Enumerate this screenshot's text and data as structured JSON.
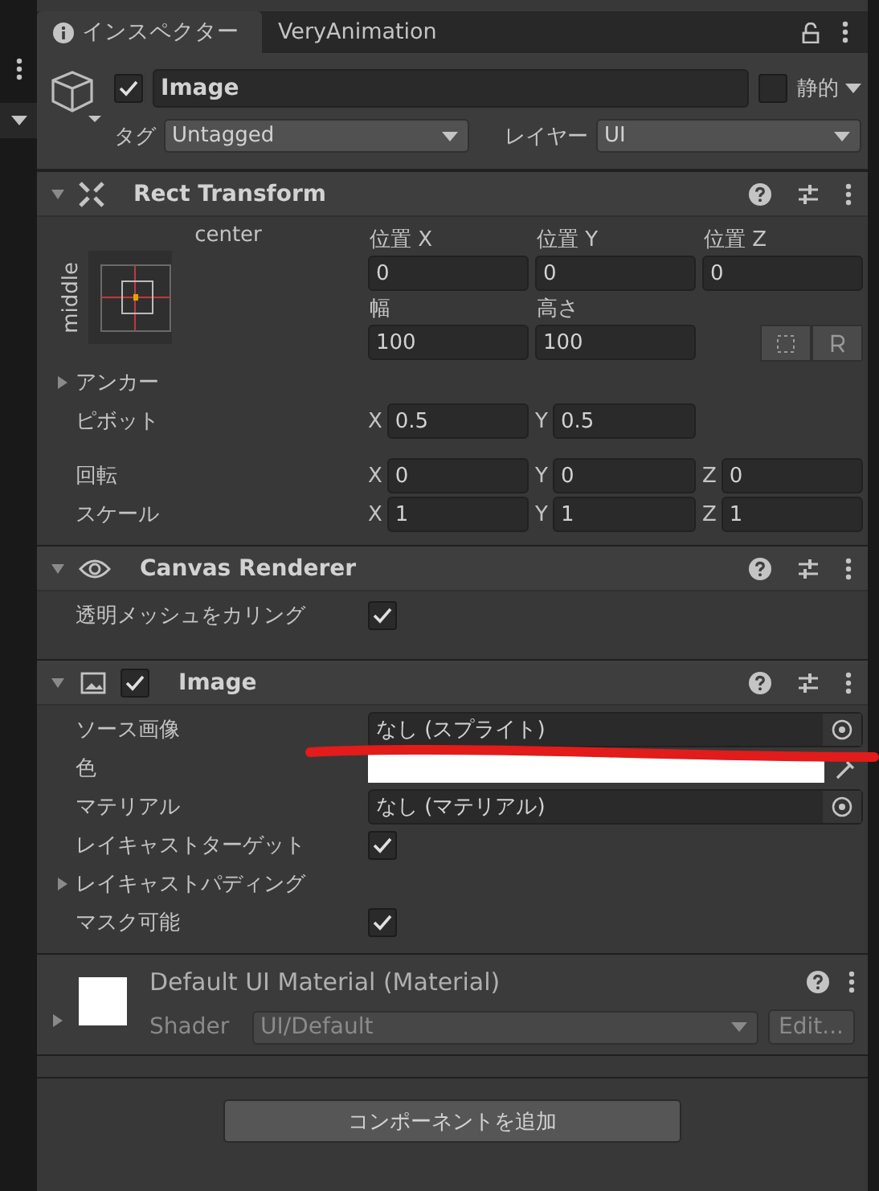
{
  "tabs": [
    {
      "label": "インスペクター",
      "selected": true
    },
    {
      "label": "VeryAnimation",
      "selected": false
    }
  ],
  "game_object": {
    "active": true,
    "name": "Image",
    "static": false,
    "static_label": "静的",
    "tag_label": "タグ",
    "tag": "Untagged",
    "layer_label": "レイヤー",
    "layer": "UI"
  },
  "rect_transform": {
    "title": "Rect Transform",
    "expanded": true,
    "anchor_h": "center",
    "anchor_v": "middle",
    "top_fields": [
      {
        "label": "位置 X",
        "value": "0"
      },
      {
        "label": "位置 Y",
        "value": "0"
      },
      {
        "label": "位置 Z",
        "value": "0"
      },
      {
        "label": "幅",
        "value": "100"
      },
      {
        "label": "高さ",
        "value": "100"
      }
    ],
    "anchors": {
      "label": "アンカー",
      "expanded": false
    },
    "vector_rows": [
      {
        "label": "ピボット",
        "fields": [
          {
            "axis": "X",
            "value": "0.5"
          },
          {
            "axis": "Y",
            "value": "0.5"
          }
        ]
      },
      {
        "label": "回転",
        "fields": [
          {
            "axis": "X",
            "value": "0"
          },
          {
            "axis": "Y",
            "value": "0"
          },
          {
            "axis": "Z",
            "value": "0"
          }
        ]
      },
      {
        "label": "スケール",
        "fields": [
          {
            "axis": "X",
            "value": "1"
          },
          {
            "axis": "Y",
            "value": "1"
          },
          {
            "axis": "Z",
            "value": "1"
          }
        ]
      }
    ]
  },
  "canvas_renderer": {
    "title": "Canvas Renderer",
    "expanded": true,
    "rows": [
      {
        "kind": "checkbox",
        "label": "透明メッシュをカリング",
        "checked": true
      }
    ]
  },
  "image": {
    "title": "Image",
    "expanded": true,
    "enabled": true,
    "rows": [
      {
        "kind": "object",
        "label": "ソース画像",
        "value": "なし (スプライト)"
      },
      {
        "kind": "color",
        "label": "色",
        "color": "#ffffff"
      },
      {
        "kind": "object",
        "label": "マテリアル",
        "value": "なし (マテリアル)"
      },
      {
        "kind": "checkbox",
        "label": "レイキャストターゲット",
        "checked": true
      },
      {
        "kind": "foldout",
        "label": "レイキャストパディング",
        "expanded": false
      },
      {
        "kind": "checkbox",
        "label": "マスク可能",
        "checked": true
      }
    ]
  },
  "material": {
    "title": "Default UI Material (Material)",
    "expanded": false,
    "shader_label": "Shader",
    "shader": "UI/Default",
    "edit_button": "Edit..."
  },
  "add_component_button": "コンポーネントを追加"
}
